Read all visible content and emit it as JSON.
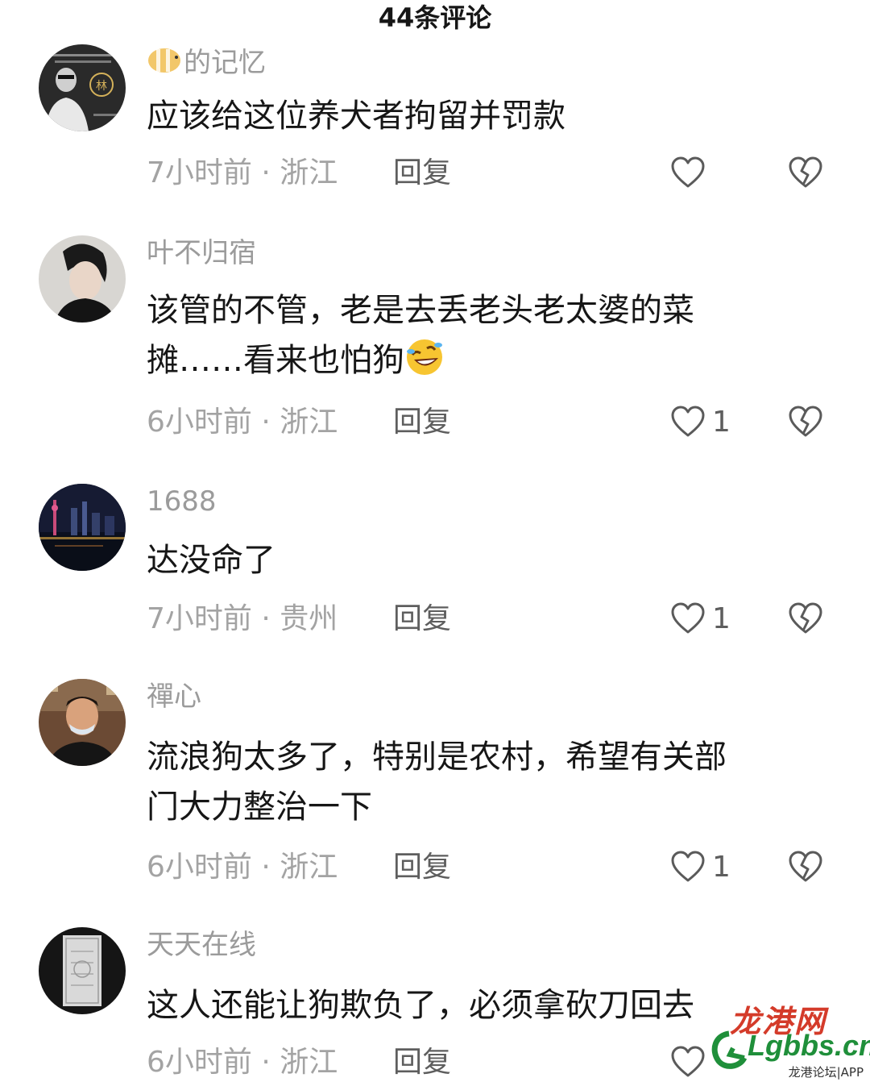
{
  "header": {
    "title": "44条评论"
  },
  "comments": [
    {
      "username": "的记忆",
      "text_lines": [
        "应该给这位养犬者拘留并罚款"
      ],
      "time_location": "7小时前 · 浙江",
      "reply_label": "回复",
      "like_count": ""
    },
    {
      "username": "叶不归宿",
      "text_lines": [
        "该管的不管，老是去丢老头老太婆的菜",
        "摊……看来也怕狗"
      ],
      "time_location": "6小时前 · 浙江",
      "reply_label": "回复",
      "like_count": "1"
    },
    {
      "username": "1688",
      "text_lines": [
        "达没命了"
      ],
      "time_location": "7小时前 · 贵州",
      "reply_label": "回复",
      "like_count": "1"
    },
    {
      "username": "禪心",
      "text_lines": [
        "流浪狗太多了，特别是农村，希望有关部",
        "门大力整治一下"
      ],
      "time_location": "6小时前 · 浙江",
      "reply_label": "回复",
      "like_count": "1"
    },
    {
      "username": "天天在线",
      "text_lines": [
        "这人还能让狗欺负了，必须拿砍刀回去"
      ],
      "time_location": "6小时前 · 浙江",
      "reply_label": "回复",
      "like_count": ""
    }
  ],
  "icons": {
    "like": "heart-outline-icon",
    "dislike": "broken-heart-icon",
    "emoji": "rolling-on-floor-laughing-emoji",
    "username_prefix": "fish-icon"
  },
  "watermark": {
    "title": "龙港网",
    "domain": "Lgbbs.cn",
    "subtitle": "龙港论坛|APP"
  },
  "colors": {
    "text_primary": "#161616",
    "text_secondary": "#9b9b9b",
    "watermark_red": "#d43b2a",
    "watermark_green": "#1f8f3a"
  }
}
